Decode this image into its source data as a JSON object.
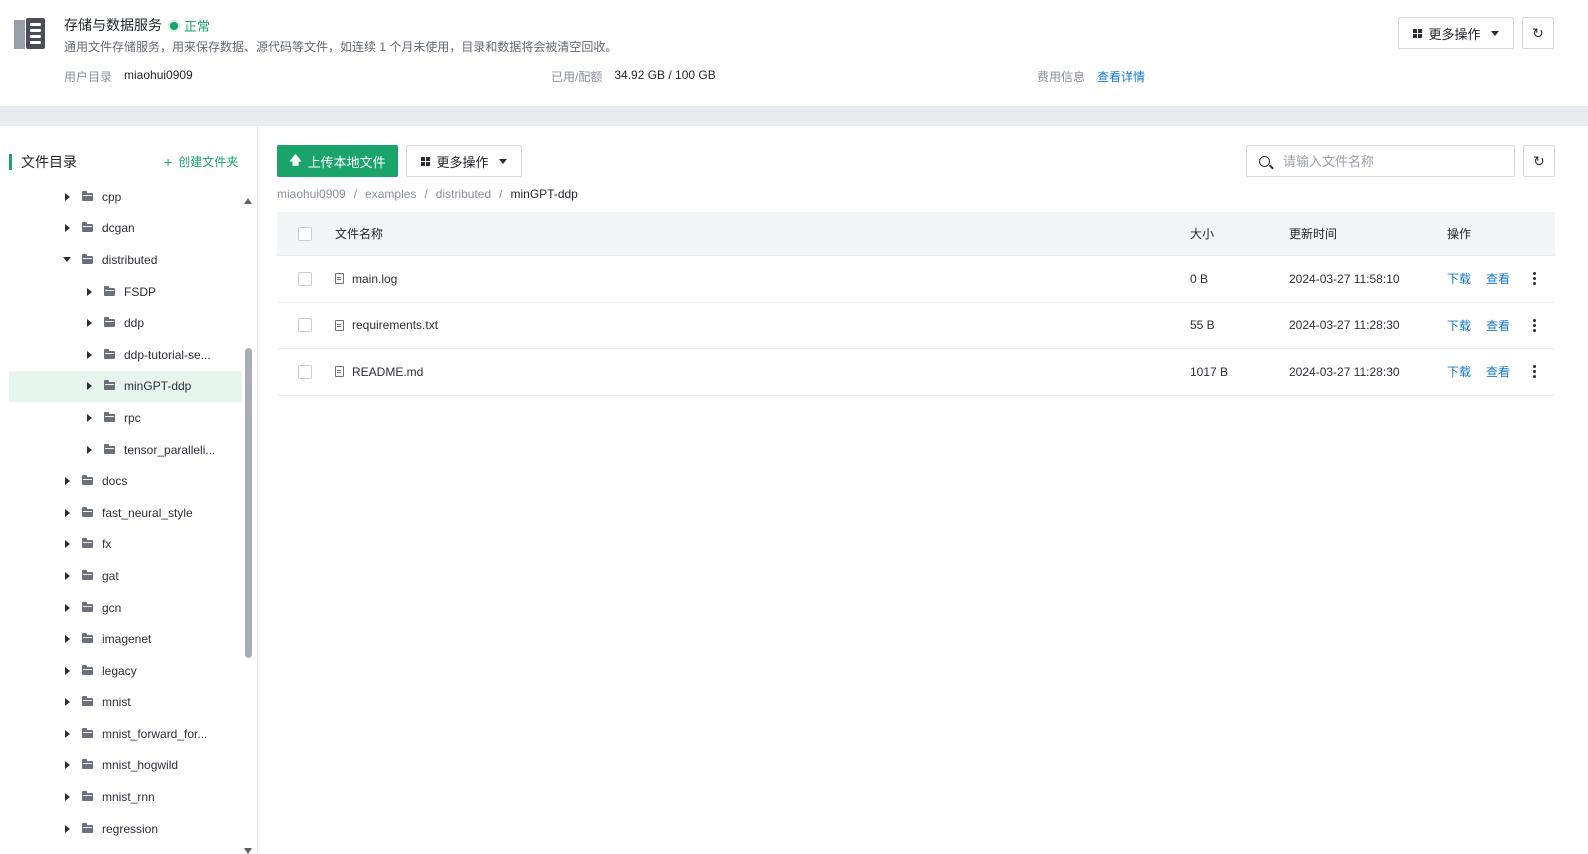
{
  "header": {
    "service_title": "存储与数据服务",
    "status": "正常",
    "description": "通用文件存储服务，用来保存数据、源代码等文件，如连续 1 个月未使用，目录和数据将会被清空回收。",
    "user_dir_label": "用户目录",
    "user_dir_value": "miaohui0909",
    "usage_label": "已用/配额",
    "usage_value": "34.92 GB / 100 GB",
    "fee_label": "费用信息",
    "fee_link": "查看详情",
    "more_actions": "更多操作",
    "refresh_icon": "↻"
  },
  "sidebar": {
    "title": "文件目录",
    "create_folder": "创建文件夹",
    "create_plus": "+",
    "items": [
      {
        "label": "cpp",
        "level": 1,
        "expanded": false,
        "selected": false
      },
      {
        "label": "dcgan",
        "level": 1,
        "expanded": false,
        "selected": false
      },
      {
        "label": "distributed",
        "level": 1,
        "expanded": true,
        "selected": false
      },
      {
        "label": "FSDP",
        "level": 2,
        "expanded": false,
        "selected": false
      },
      {
        "label": "ddp",
        "level": 2,
        "expanded": false,
        "selected": false
      },
      {
        "label": "ddp-tutorial-se...",
        "level": 2,
        "expanded": false,
        "selected": false
      },
      {
        "label": "minGPT-ddp",
        "level": 2,
        "expanded": false,
        "selected": true
      },
      {
        "label": "rpc",
        "level": 2,
        "expanded": false,
        "selected": false
      },
      {
        "label": "tensor_paralleli...",
        "level": 2,
        "expanded": false,
        "selected": false
      },
      {
        "label": "docs",
        "level": 1,
        "expanded": false,
        "selected": false
      },
      {
        "label": "fast_neural_style",
        "level": 1,
        "expanded": false,
        "selected": false
      },
      {
        "label": "fx",
        "level": 1,
        "expanded": false,
        "selected": false
      },
      {
        "label": "gat",
        "level": 1,
        "expanded": false,
        "selected": false
      },
      {
        "label": "gcn",
        "level": 1,
        "expanded": false,
        "selected": false
      },
      {
        "label": "imagenet",
        "level": 1,
        "expanded": false,
        "selected": false
      },
      {
        "label": "legacy",
        "level": 1,
        "expanded": false,
        "selected": false
      },
      {
        "label": "mnist",
        "level": 1,
        "expanded": false,
        "selected": false
      },
      {
        "label": "mnist_forward_for...",
        "level": 1,
        "expanded": false,
        "selected": false
      },
      {
        "label": "mnist_hogwild",
        "level": 1,
        "expanded": false,
        "selected": false
      },
      {
        "label": "mnist_rnn",
        "level": 1,
        "expanded": false,
        "selected": false
      },
      {
        "label": "regression",
        "level": 1,
        "expanded": false,
        "selected": false
      }
    ]
  },
  "main": {
    "upload_label": "上传本地文件",
    "upload_icon": "🡅",
    "more_actions": "更多操作",
    "search_placeholder": "请输入文件名称",
    "refresh_icon": "↻",
    "breadcrumb": [
      "miaohui0909",
      "examples",
      "distributed",
      "minGPT-ddp"
    ],
    "breadcrumb_sep": "/",
    "table": {
      "headers": {
        "name": "文件名称",
        "size": "大小",
        "time": "更新时间",
        "ops": "操作"
      },
      "rows": [
        {
          "name": "main.log",
          "size": "0 B",
          "time": "2024-03-27 11:58:10",
          "download": "下载",
          "view": "查看"
        },
        {
          "name": "requirements.txt",
          "size": "55 B",
          "time": "2024-03-27 11:28:30",
          "download": "下载",
          "view": "查看"
        },
        {
          "name": "README.md",
          "size": "1017 B",
          "time": "2024-03-27 11:28:30",
          "download": "下载",
          "view": "查看"
        }
      ]
    }
  },
  "colors": {
    "accent": "#1aa36b",
    "link": "#1677d2",
    "selected_bg": "#e6f6ee"
  }
}
